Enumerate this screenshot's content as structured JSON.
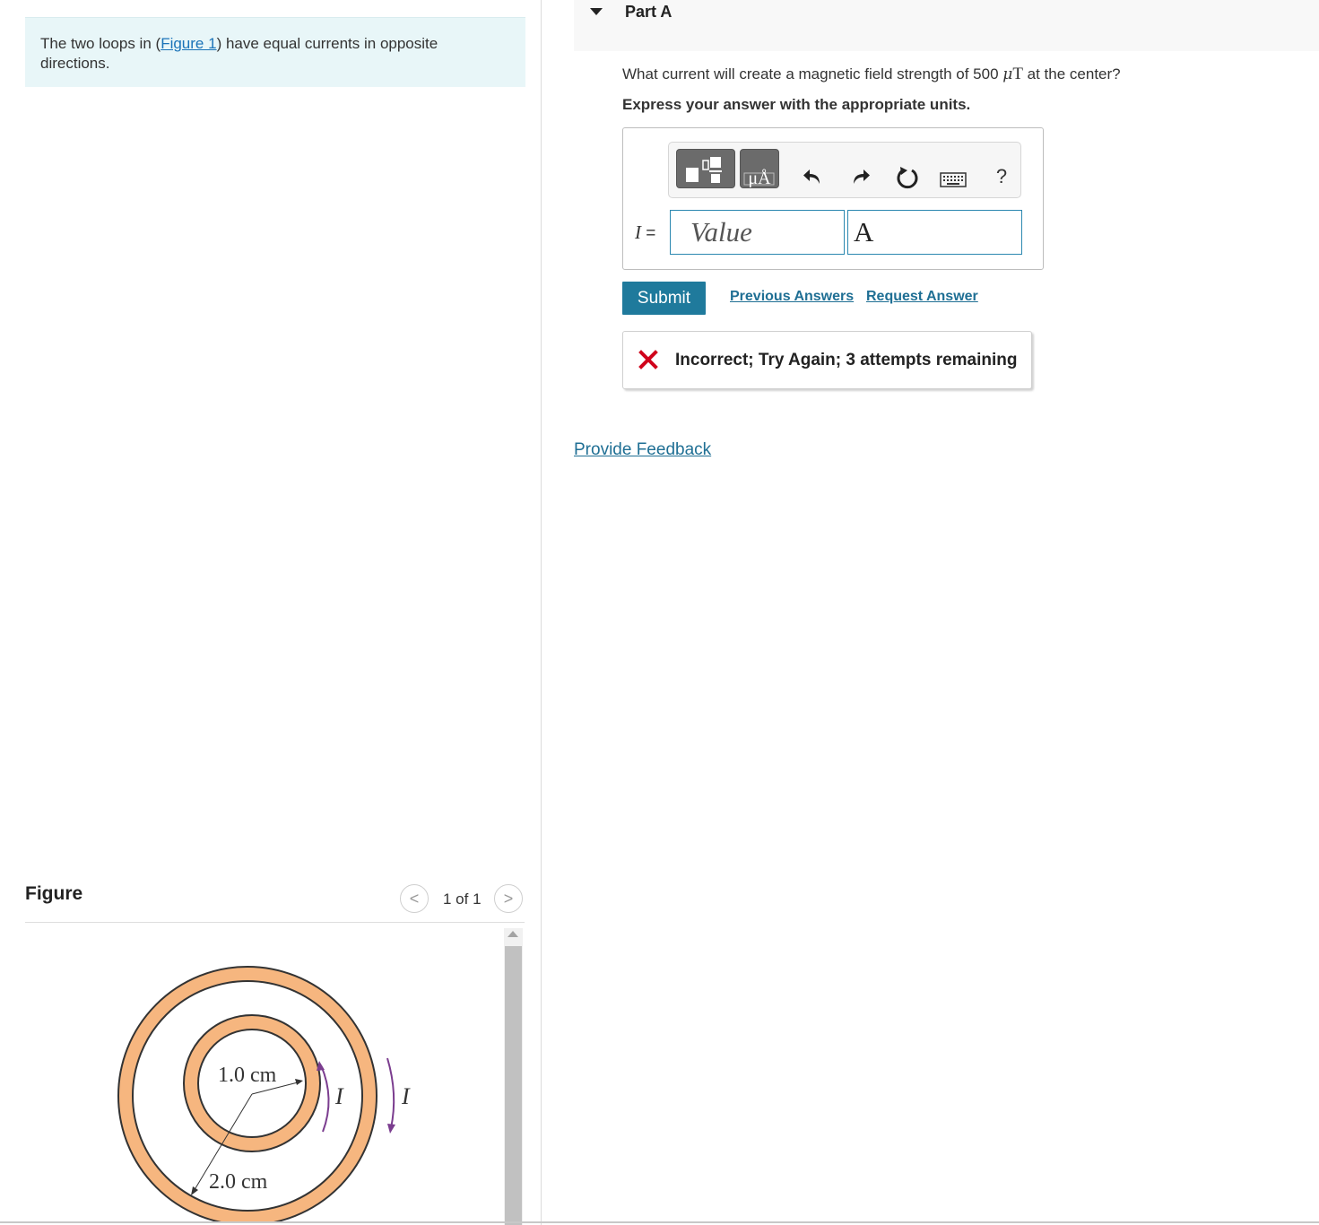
{
  "problem": {
    "text_before": "The two loops in (",
    "figure_link": "Figure 1",
    "text_after": ") have equal currents in opposite directions."
  },
  "figure": {
    "heading": "Figure",
    "counter": "1 of 1",
    "prev_glyph": "<",
    "next_glyph": ">",
    "inner_label": "1.0 cm",
    "outer_label": "2.0 cm",
    "current_label_inner": "I",
    "current_label_outer": "I",
    "colors": {
      "loop_fill": "#f6b67f",
      "loop_stroke": "#333333",
      "arrow": "#7b3d8f"
    }
  },
  "part": {
    "caret": "expanded",
    "title": "Part A",
    "question_before": "What current will create a magnetic field strength of 500 ",
    "question_mu": "μ",
    "question_unit": "T",
    "question_after": " at the center?",
    "instructions": "Express your answer with the appropriate units."
  },
  "toolbar": {
    "templates_icon": "templates-icon",
    "units_label": "μÅ",
    "undo_icon": "undo-icon",
    "redo_icon": "redo-icon",
    "reset_icon": "reset-icon",
    "keyboard_icon": "keyboard-icon",
    "help_label": "?"
  },
  "answer": {
    "variable": "I",
    "equals": " =",
    "value_placeholder": "Value",
    "value": "",
    "unit_value": "A"
  },
  "actions": {
    "submit_label": "Submit",
    "previous_answers": "Previous Answers",
    "request_answer": "Request Answer"
  },
  "feedback": {
    "message": "Incorrect; Try Again; 3 attempts remaining",
    "status_color": "#d0021b"
  },
  "provide_feedback": "Provide Feedback",
  "colors": {
    "accent": "#1f7a9c",
    "link": "#1f6f94",
    "problem_bg": "#e8f6f8"
  }
}
